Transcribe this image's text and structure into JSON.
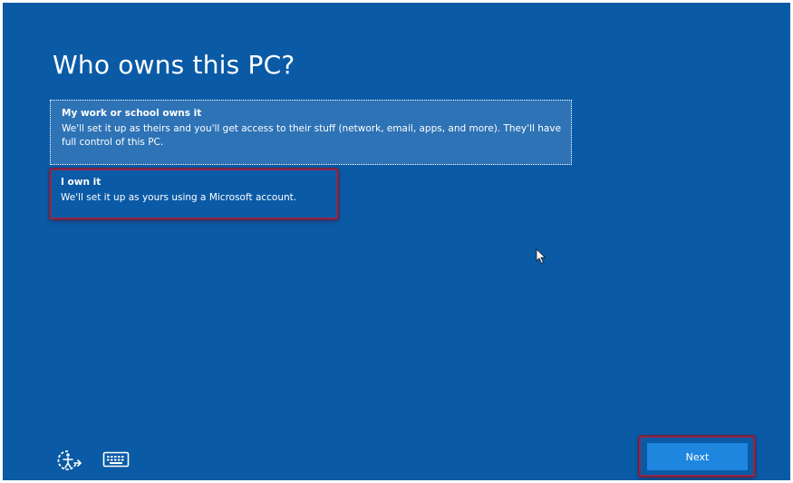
{
  "page": {
    "title": "Who owns this PC?"
  },
  "options": [
    {
      "title": "My work or school owns it",
      "description": "We'll set it up as theirs and you'll get access to their stuff (network, email, apps, and more). They'll have full control of this PC."
    },
    {
      "title": "I own it",
      "description": "We'll set it up as yours using a Microsoft account."
    }
  ],
  "footer": {
    "ease_of_access_icon": "ease-of-access-icon",
    "keyboard_icon": "keyboard-icon",
    "next_label": "Next"
  },
  "colors": {
    "background": "#0a5aa6",
    "selected_option": "#2e73b6",
    "next_button": "#1f86e0",
    "highlight_annotation": "#8a2a4a"
  }
}
